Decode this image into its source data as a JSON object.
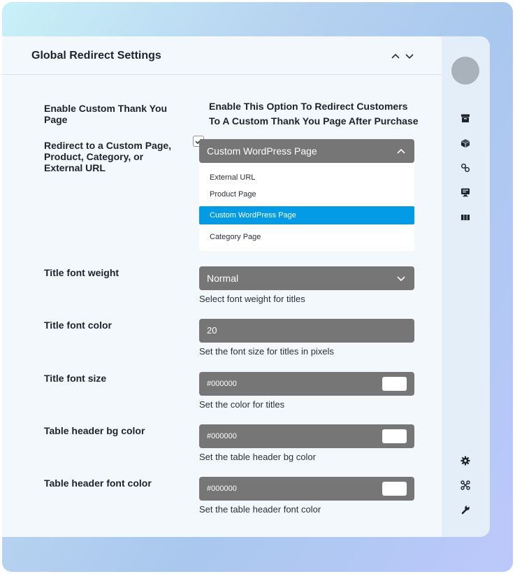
{
  "header": {
    "title": "Global Redirect Settings"
  },
  "settings": {
    "thank_you": {
      "label": "Enable Custom Thank You Page",
      "checked": true,
      "description": "Enable This Option To Redirect Customers To A Custom Thank You Page After Purchase"
    },
    "redirect": {
      "label": "Redirect to a Custom Page, Product, Category, or External URL",
      "selected": "Custom WordPress Page",
      "options": [
        "External URL",
        "Product Page",
        "Custom WordPress Page",
        "Category Page"
      ]
    },
    "title_font_weight": {
      "label": "Title font weight",
      "value": "Normal",
      "help": "Select font weight for titles"
    },
    "title_font_color": {
      "label": "Title font color",
      "value": "20",
      "help": "Set the font size for titles in pixels"
    },
    "title_font_size": {
      "label": "Title font size",
      "value": "#000000",
      "help": "Set the color for titles"
    },
    "table_header_bg": {
      "label": "Table header bg color",
      "value": "#000000",
      "help": "Set the table header bg color"
    },
    "table_header_font": {
      "label": "Table header font color",
      "value": "#000000",
      "help": "Set the table header font color"
    }
  },
  "rail": {
    "icons": [
      "archive-icon",
      "cube-icon",
      "link-icon",
      "monitor-icon",
      "columns-icon",
      "gear-icon",
      "scissors-icon",
      "wrench-icon"
    ]
  },
  "colors": {
    "field_bg": "#767676",
    "selected_option": "#039be5",
    "panel_bg": "#f3f8fc",
    "rail_bg": "#e3eef9"
  }
}
